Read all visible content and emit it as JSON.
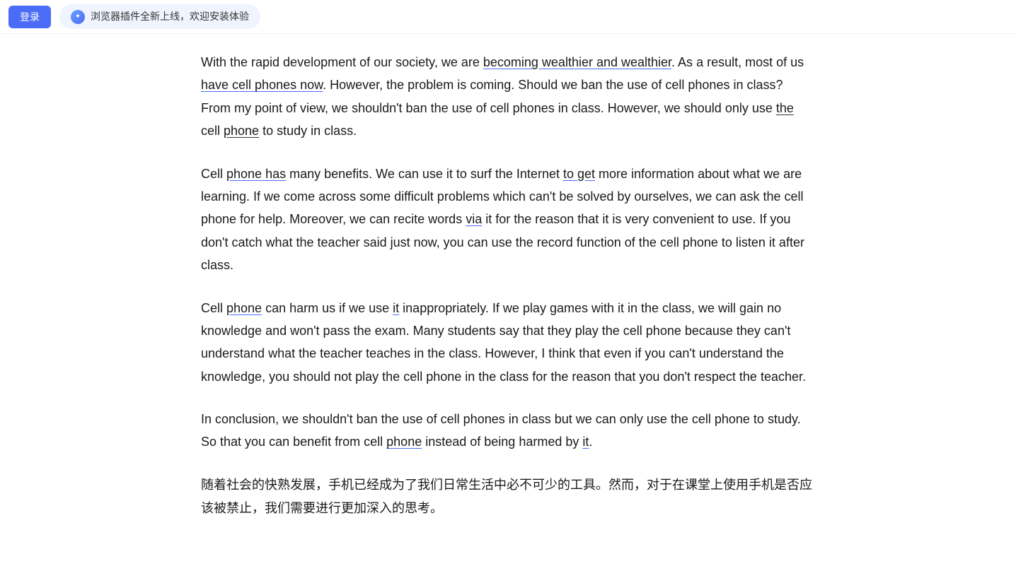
{
  "header": {
    "login_label": "登录",
    "plugin_text": "浏览器插件全新上线，欢迎安装体验"
  },
  "article": {
    "paragraphs": [
      {
        "id": "p1",
        "text_parts": [
          {
            "text": "With the rapid development of our society, we are ",
            "style": "normal"
          },
          {
            "text": "becoming wealthier and wealthier",
            "style": "underline-blue"
          },
          {
            "text": ". As a result, most of us ",
            "style": "normal"
          },
          {
            "text": "have cell phones now",
            "style": "underline-blue"
          },
          {
            "text": ". However, the problem is coming. Should we ban the use of cell phones in class? From my point of view, we shouldn’t ban the use of cell phones in class. However, we should only use ",
            "style": "normal"
          },
          {
            "text": "the",
            "style": "underline-dark"
          },
          {
            "text": " cell ",
            "style": "normal"
          },
          {
            "text": "phone",
            "style": "underline-dark"
          },
          {
            "text": " to study in class.",
            "style": "normal"
          }
        ]
      },
      {
        "id": "p2",
        "text_parts": [
          {
            "text": "Cell ",
            "style": "normal"
          },
          {
            "text": "phone has",
            "style": "underline-blue"
          },
          {
            "text": " many benefits. We can use it to surf the Internet ",
            "style": "normal"
          },
          {
            "text": "to get",
            "style": "underline-blue"
          },
          {
            "text": " more information about what we are learning. If we come across some difficult problems which can’t be solved by ourselves, we can ask the cell phone for help. Moreover, we can recite words ",
            "style": "normal"
          },
          {
            "text": "via",
            "style": "underline-blue"
          },
          {
            "text": " it for the reason that it is very convenient to use. If you don’t catch what the teacher said just now, you can use the record function of the cell phone to listen it after class.",
            "style": "normal"
          }
        ]
      },
      {
        "id": "p3",
        "text_parts": [
          {
            "text": "Cell ",
            "style": "normal"
          },
          {
            "text": "phone",
            "style": "underline-blue"
          },
          {
            "text": " can harm us if we use ",
            "style": "normal"
          },
          {
            "text": "it",
            "style": "underline-blue"
          },
          {
            "text": " inappropriately. If we play games with it in the class, we will gain no knowledge and won’t pass the exam. Many students say that they play the cell phone because they can’t understand what the teacher teaches in the class. However, I think that even if you can’t understand the knowledge, you should not play the cell phone in the class for the reason that you don’t respect the teacher.",
            "style": "normal"
          }
        ]
      },
      {
        "id": "p4",
        "text_parts": [
          {
            "text": "In conclusion, we shouldn’t ban the use of cell phones in class but we can only use the cell phone to study. So that you can benefit from cell ",
            "style": "normal"
          },
          {
            "text": "phone",
            "style": "underline-blue"
          },
          {
            "text": " instead of being harmed by ",
            "style": "normal"
          },
          {
            "text": "it",
            "style": "underline-blue"
          },
          {
            "text": ".",
            "style": "normal"
          }
        ]
      },
      {
        "id": "p5",
        "text_parts": [
          {
            "text": "随着社会的快熟发展，手机已经成为了我们日常生活中必不可少的工具。然而，对于在课堂上使用手机是否应该被禁止，我们需要进行更加深入的思考。",
            "style": "chinese"
          }
        ]
      }
    ]
  }
}
